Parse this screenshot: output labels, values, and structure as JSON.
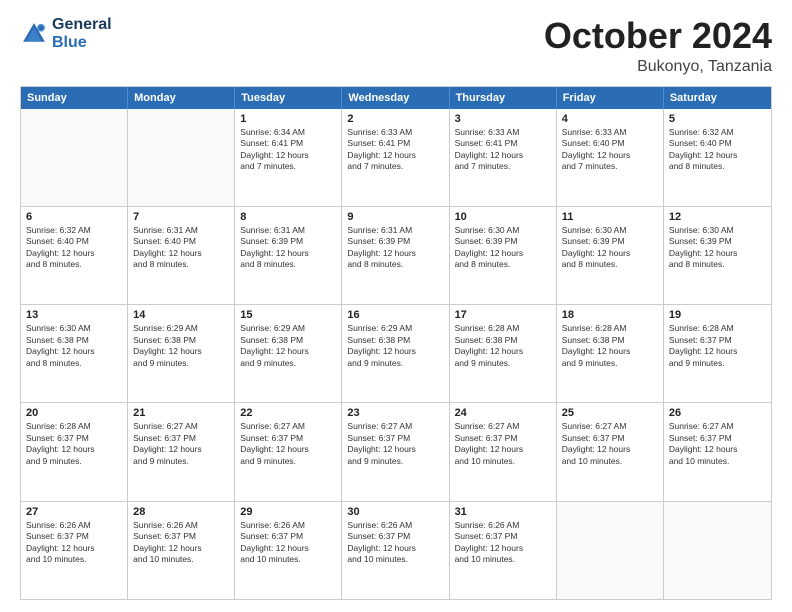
{
  "logo": {
    "line1": "General",
    "line2": "Blue"
  },
  "title": "October 2024",
  "location": "Bukonyo, Tanzania",
  "header_days": [
    "Sunday",
    "Monday",
    "Tuesday",
    "Wednesday",
    "Thursday",
    "Friday",
    "Saturday"
  ],
  "weeks": [
    [
      {
        "day": "",
        "info": ""
      },
      {
        "day": "",
        "info": ""
      },
      {
        "day": "1",
        "info": "Sunrise: 6:34 AM\nSunset: 6:41 PM\nDaylight: 12 hours\nand 7 minutes."
      },
      {
        "day": "2",
        "info": "Sunrise: 6:33 AM\nSunset: 6:41 PM\nDaylight: 12 hours\nand 7 minutes."
      },
      {
        "day": "3",
        "info": "Sunrise: 6:33 AM\nSunset: 6:41 PM\nDaylight: 12 hours\nand 7 minutes."
      },
      {
        "day": "4",
        "info": "Sunrise: 6:33 AM\nSunset: 6:40 PM\nDaylight: 12 hours\nand 7 minutes."
      },
      {
        "day": "5",
        "info": "Sunrise: 6:32 AM\nSunset: 6:40 PM\nDaylight: 12 hours\nand 8 minutes."
      }
    ],
    [
      {
        "day": "6",
        "info": "Sunrise: 6:32 AM\nSunset: 6:40 PM\nDaylight: 12 hours\nand 8 minutes."
      },
      {
        "day": "7",
        "info": "Sunrise: 6:31 AM\nSunset: 6:40 PM\nDaylight: 12 hours\nand 8 minutes."
      },
      {
        "day": "8",
        "info": "Sunrise: 6:31 AM\nSunset: 6:39 PM\nDaylight: 12 hours\nand 8 minutes."
      },
      {
        "day": "9",
        "info": "Sunrise: 6:31 AM\nSunset: 6:39 PM\nDaylight: 12 hours\nand 8 minutes."
      },
      {
        "day": "10",
        "info": "Sunrise: 6:30 AM\nSunset: 6:39 PM\nDaylight: 12 hours\nand 8 minutes."
      },
      {
        "day": "11",
        "info": "Sunrise: 6:30 AM\nSunset: 6:39 PM\nDaylight: 12 hours\nand 8 minutes."
      },
      {
        "day": "12",
        "info": "Sunrise: 6:30 AM\nSunset: 6:39 PM\nDaylight: 12 hours\nand 8 minutes."
      }
    ],
    [
      {
        "day": "13",
        "info": "Sunrise: 6:30 AM\nSunset: 6:38 PM\nDaylight: 12 hours\nand 8 minutes."
      },
      {
        "day": "14",
        "info": "Sunrise: 6:29 AM\nSunset: 6:38 PM\nDaylight: 12 hours\nand 9 minutes."
      },
      {
        "day": "15",
        "info": "Sunrise: 6:29 AM\nSunset: 6:38 PM\nDaylight: 12 hours\nand 9 minutes."
      },
      {
        "day": "16",
        "info": "Sunrise: 6:29 AM\nSunset: 6:38 PM\nDaylight: 12 hours\nand 9 minutes."
      },
      {
        "day": "17",
        "info": "Sunrise: 6:28 AM\nSunset: 6:38 PM\nDaylight: 12 hours\nand 9 minutes."
      },
      {
        "day": "18",
        "info": "Sunrise: 6:28 AM\nSunset: 6:38 PM\nDaylight: 12 hours\nand 9 minutes."
      },
      {
        "day": "19",
        "info": "Sunrise: 6:28 AM\nSunset: 6:37 PM\nDaylight: 12 hours\nand 9 minutes."
      }
    ],
    [
      {
        "day": "20",
        "info": "Sunrise: 6:28 AM\nSunset: 6:37 PM\nDaylight: 12 hours\nand 9 minutes."
      },
      {
        "day": "21",
        "info": "Sunrise: 6:27 AM\nSunset: 6:37 PM\nDaylight: 12 hours\nand 9 minutes."
      },
      {
        "day": "22",
        "info": "Sunrise: 6:27 AM\nSunset: 6:37 PM\nDaylight: 12 hours\nand 9 minutes."
      },
      {
        "day": "23",
        "info": "Sunrise: 6:27 AM\nSunset: 6:37 PM\nDaylight: 12 hours\nand 9 minutes."
      },
      {
        "day": "24",
        "info": "Sunrise: 6:27 AM\nSunset: 6:37 PM\nDaylight: 12 hours\nand 10 minutes."
      },
      {
        "day": "25",
        "info": "Sunrise: 6:27 AM\nSunset: 6:37 PM\nDaylight: 12 hours\nand 10 minutes."
      },
      {
        "day": "26",
        "info": "Sunrise: 6:27 AM\nSunset: 6:37 PM\nDaylight: 12 hours\nand 10 minutes."
      }
    ],
    [
      {
        "day": "27",
        "info": "Sunrise: 6:26 AM\nSunset: 6:37 PM\nDaylight: 12 hours\nand 10 minutes."
      },
      {
        "day": "28",
        "info": "Sunrise: 6:26 AM\nSunset: 6:37 PM\nDaylight: 12 hours\nand 10 minutes."
      },
      {
        "day": "29",
        "info": "Sunrise: 6:26 AM\nSunset: 6:37 PM\nDaylight: 12 hours\nand 10 minutes."
      },
      {
        "day": "30",
        "info": "Sunrise: 6:26 AM\nSunset: 6:37 PM\nDaylight: 12 hours\nand 10 minutes."
      },
      {
        "day": "31",
        "info": "Sunrise: 6:26 AM\nSunset: 6:37 PM\nDaylight: 12 hours\nand 10 minutes."
      },
      {
        "day": "",
        "info": ""
      },
      {
        "day": "",
        "info": ""
      }
    ]
  ]
}
